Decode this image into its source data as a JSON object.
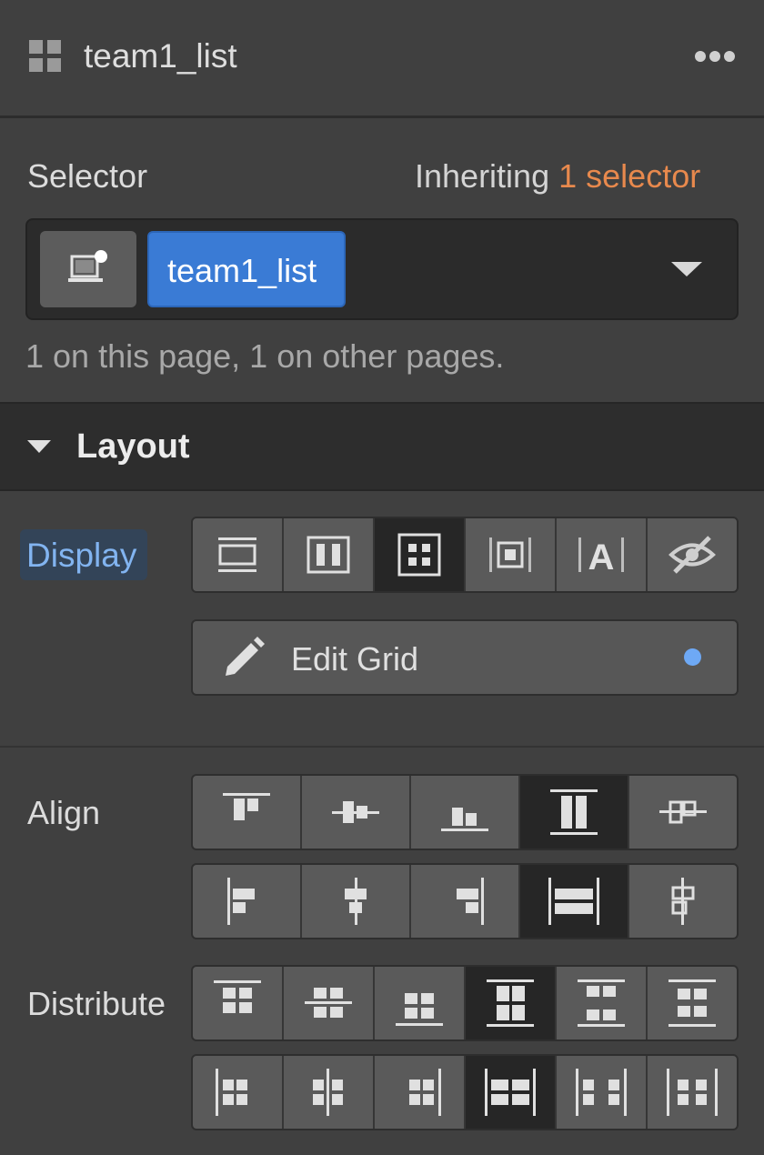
{
  "header": {
    "title": "team1_list",
    "icon": "grid-squares-icon",
    "menu_icon": "more-horizontal-icon"
  },
  "selector": {
    "label": "Selector",
    "inheriting_prefix": "Inheriting",
    "inheriting_link": "1 selector",
    "chip_label": "team1_list",
    "device_icon": "device-breakpoint-icon",
    "info": "1 on this page, 1 on other pages."
  },
  "layout": {
    "section_title": "Layout",
    "display_label": "Display",
    "display_options": [
      {
        "name": "display-block-button",
        "icon": "block-icon",
        "active": false
      },
      {
        "name": "display-flex-button",
        "icon": "flex-icon",
        "active": false
      },
      {
        "name": "display-grid-button",
        "icon": "grid-icon",
        "active": true
      },
      {
        "name": "display-inline-block-button",
        "icon": "inline-block-icon",
        "active": false
      },
      {
        "name": "display-inline-button",
        "icon": "inline-text-icon",
        "active": false
      },
      {
        "name": "display-none-button",
        "icon": "eye-slash-icon",
        "active": false
      }
    ],
    "edit_grid_label": "Edit Grid",
    "align_label": "Align",
    "align_vertical_active": 3,
    "align_horizontal_active": 3,
    "distribute_label": "Distribute",
    "distribute_vertical_active": 3,
    "distribute_horizontal_active": 3
  },
  "colors": {
    "accent_orange": "#e8894d",
    "accent_blue": "#3a7bd5",
    "indicator_dot": "#6ea9f5",
    "panel_bg": "#404040"
  }
}
